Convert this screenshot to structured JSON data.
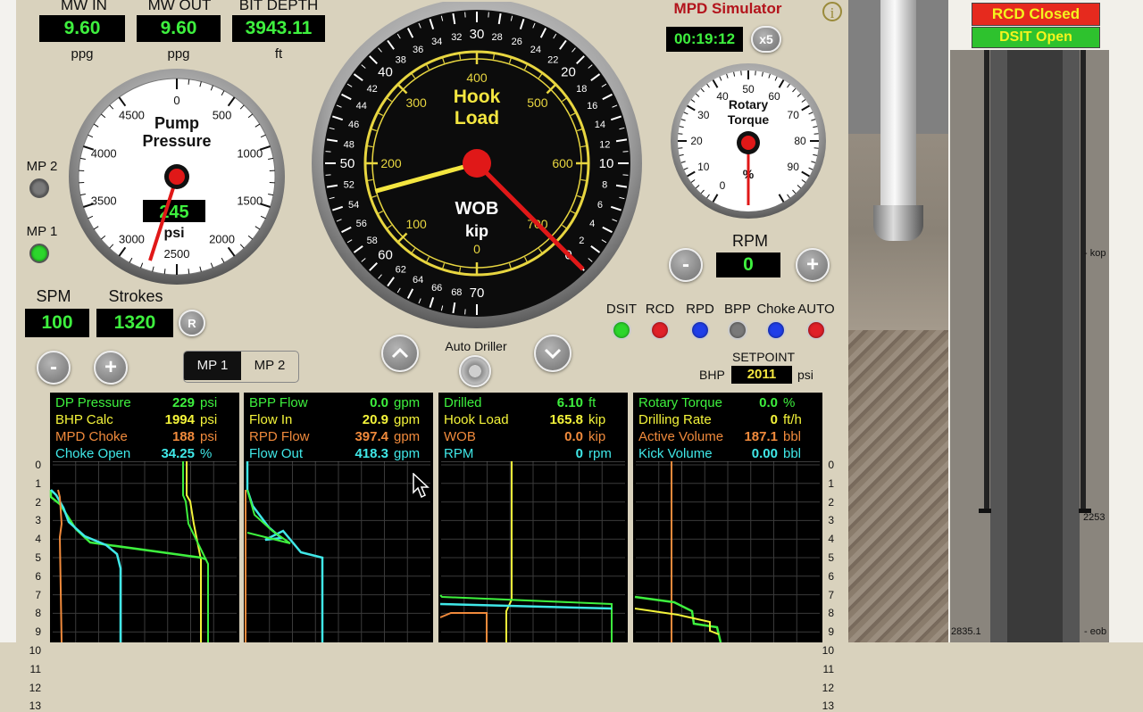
{
  "readouts": {
    "mw_in": {
      "label": "MW IN",
      "value": "9.60",
      "unit": "ppg"
    },
    "mw_out": {
      "label": "MW OUT",
      "value": "9.60",
      "unit": "ppg"
    },
    "bit_depth": {
      "label": "BIT DEPTH",
      "value": "3943.11",
      "unit": "ft"
    }
  },
  "pump_gauge": {
    "title_line1": "Pump",
    "title_line2": "Pressure",
    "value": "245",
    "unit": "psi",
    "ticks": [
      "0",
      "500",
      "1000",
      "1500",
      "2000",
      "2500",
      "3000",
      "3500",
      "4000",
      "4500"
    ]
  },
  "pumps": {
    "mp2_label": "MP 2",
    "mp1_label": "MP 1",
    "mp2_on": false,
    "mp1_on": true
  },
  "spm": {
    "label": "SPM",
    "value": "100"
  },
  "strokes": {
    "label": "Strokes",
    "value": "1320",
    "reset": "R"
  },
  "mp_toggle": {
    "minus": "-",
    "plus": "+",
    "mp1": "MP 1",
    "mp2": "MP 2"
  },
  "hook_gauge": {
    "title_line1": "Hook",
    "title_line2": "Load",
    "sub_line1": "WOB",
    "sub_line2": "kip",
    "outer_ticks": [
      "0",
      "2",
      "4",
      "6",
      "8",
      "10",
      "12",
      "14",
      "16",
      "18",
      "20",
      "22",
      "24",
      "26",
      "28",
      "30",
      "32",
      "34",
      "36",
      "38",
      "40",
      "42",
      "44",
      "46",
      "48",
      "50",
      "52",
      "54",
      "56",
      "58",
      "60",
      "62",
      "64",
      "66",
      "68",
      "70"
    ],
    "inner_ticks": [
      "0",
      "100",
      "200",
      "300",
      "400",
      "500",
      "600",
      "700"
    ],
    "hook_load_kip": 165.8,
    "wob_kip": 0.0
  },
  "auto_driller": {
    "label": "Auto Driller"
  },
  "sim": {
    "title": "MPD Simulator",
    "time": "00:19:12",
    "speed": "x5",
    "info": "i"
  },
  "torque_gauge": {
    "title_line1": "Rotary",
    "title_line2": "Torque",
    "unit": "%",
    "ticks": [
      "0",
      "10",
      "20",
      "30",
      "40",
      "50",
      "60",
      "70",
      "80",
      "90"
    ]
  },
  "rpm": {
    "label": "RPM",
    "value": "0",
    "minus": "-",
    "plus": "+"
  },
  "indicators": [
    {
      "label": "DSIT",
      "color": "#2cd62c"
    },
    {
      "label": "RCD",
      "color": "#e0202a"
    },
    {
      "label": "RPD",
      "color": "#1f3ee8"
    },
    {
      "label": "BPP",
      "color": "#7a7a7a"
    },
    {
      "label": "Choke",
      "color": "#1f3ee8"
    },
    {
      "label": "AUTO",
      "color": "#e0202a"
    }
  ],
  "setpoint": {
    "title": "SETPOINT",
    "prefix": "BHP",
    "value": "2011",
    "unit": "psi"
  },
  "status": {
    "rcd": "RCD Closed",
    "dsit": "DSIT Open"
  },
  "panels": [
    {
      "rows": [
        {
          "name": "DP Pressure",
          "value": "229",
          "unit": "psi",
          "color": "#3ef03e"
        },
        {
          "name": "BHP Calc",
          "value": "1994",
          "unit": "psi",
          "color": "#f4f43a"
        },
        {
          "name": "MPD Choke",
          "value": "188",
          "unit": "psi",
          "color": "#f08a3c"
        },
        {
          "name": "Choke Open",
          "value": "34.25",
          "unit": "%",
          "color": "#40e8e8"
        }
      ]
    },
    {
      "rows": [
        {
          "name": "BPP Flow",
          "value": "0.0",
          "unit": "gpm",
          "color": "#3ef03e"
        },
        {
          "name": "Flow In",
          "value": "20.9",
          "unit": "gpm",
          "color": "#f4f43a"
        },
        {
          "name": "RPD Flow",
          "value": "397.4",
          "unit": "gpm",
          "color": "#f08a3c"
        },
        {
          "name": "Flow Out",
          "value": "418.3",
          "unit": "gpm",
          "color": "#40e8e8"
        }
      ]
    },
    {
      "rows": [
        {
          "name": "Drilled",
          "value": "6.10",
          "unit": "ft",
          "color": "#3ef03e"
        },
        {
          "name": "Hook Load",
          "value": "165.8",
          "unit": "kip",
          "color": "#f4f43a"
        },
        {
          "name": "WOB",
          "value": "0.0",
          "unit": "kip",
          "color": "#f08a3c"
        },
        {
          "name": "RPM",
          "value": "0",
          "unit": "rpm",
          "color": "#40e8e8"
        }
      ]
    },
    {
      "rows": [
        {
          "name": "Rotary Torque",
          "value": "0.0",
          "unit": "%",
          "color": "#3ef03e"
        },
        {
          "name": "Drilling Rate",
          "value": "0",
          "unit": "ft/h",
          "color": "#f4f43a"
        },
        {
          "name": "Active Volume",
          "value": "187.1",
          "unit": "bbl",
          "color": "#f08a3c"
        },
        {
          "name": "Kick Volume",
          "value": "0.00",
          "unit": "bbl",
          "color": "#40e8e8"
        }
      ]
    }
  ],
  "time_axis": [
    "0",
    "1",
    "2",
    "3",
    "4",
    "5",
    "6",
    "7",
    "8",
    "9",
    "10",
    "11",
    "12",
    "13"
  ],
  "well": {
    "kop": "- kop",
    "eob": "- eob",
    "depth1": "2253",
    "depth2": "2835.1"
  }
}
